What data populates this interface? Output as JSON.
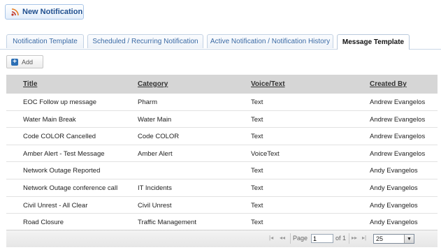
{
  "toolbar": {
    "new_notification_label": "New Notification"
  },
  "tabs": [
    {
      "label": "Notification Template"
    },
    {
      "label": "Scheduled / Recurring Notification"
    },
    {
      "label": "Active Notification / Notification History"
    },
    {
      "label": "Message Template",
      "active": true
    }
  ],
  "actions": {
    "add_label": "Add"
  },
  "table": {
    "headers": [
      "Title",
      "Category",
      "Voice/Text",
      "Created By"
    ],
    "rows": [
      [
        "EOC Follow up message",
        "Pharm",
        "Text",
        "Andrew Evangelos"
      ],
      [
        "Water Main Break",
        "Water Main",
        "Text",
        "Andrew Evangelos"
      ],
      [
        "Code COLOR Cancelled",
        "Code COLOR",
        "Text",
        "Andrew Evangelos"
      ],
      [
        "Amber Alert - Test Message",
        "Amber Alert",
        "VoiceText",
        "Andrew Evangelos"
      ],
      [
        "Network Outage Reported",
        "",
        "Text",
        "Andy Evangelos"
      ],
      [
        "Network Outage conference call",
        "IT Incidents",
        "Text",
        "Andy Evangelos"
      ],
      [
        "Civil Unrest -  All Clear",
        "Civil Unrest",
        "Text",
        "Andy Evangelos"
      ],
      [
        "Road Closure",
        "Traffic Management",
        "Text",
        "Andy Evangelos"
      ]
    ]
  },
  "pager": {
    "page_label": "Page",
    "page_value": "1",
    "of_label": "of 1",
    "page_size": "25",
    "icons": {
      "first": "first-page-icon",
      "prev": "prev-page-icon",
      "next": "next-page-icon",
      "last": "last-page-icon"
    }
  },
  "colors": {
    "accent": "#1f4f8f",
    "header_bg": "#d6d6d6",
    "tab_text": "#3a6aa5"
  }
}
